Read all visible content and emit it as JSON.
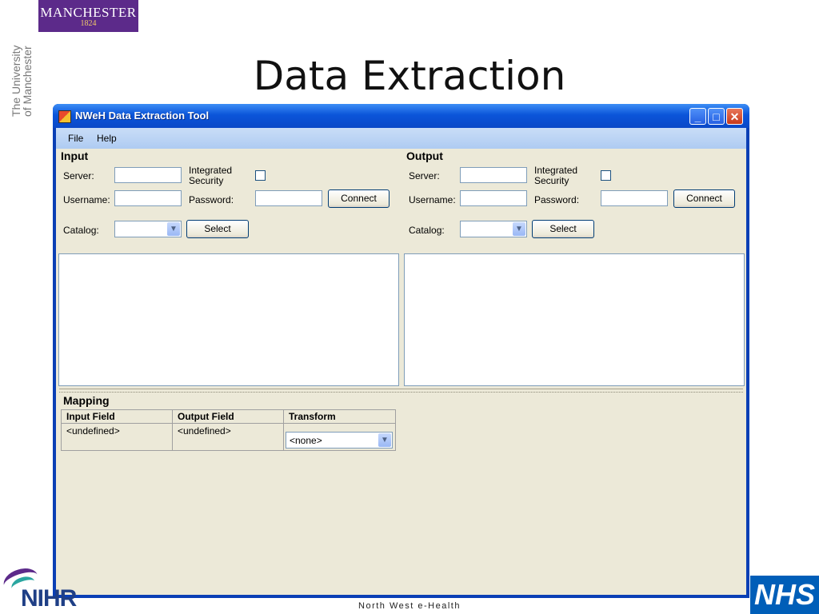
{
  "slide": {
    "title": "Data Extraction",
    "logo_name": "MANCHESTER",
    "logo_year": "1824",
    "university_line1": "The University",
    "university_line2": "of Manchester",
    "footer_text": "North West e-Health",
    "nihr_logo": "NIHR",
    "nhs_logo": "NHS"
  },
  "window": {
    "title": "NWeH Data Extraction Tool",
    "controls": [
      "minimize",
      "maximize",
      "close"
    ]
  },
  "menu": [
    "File",
    "Help"
  ],
  "input": {
    "title": "Input",
    "server_label": "Server:",
    "username_label": "Username:",
    "integrated_label_1": "Integrated",
    "integrated_label_2": "Security",
    "integrated_checked": false,
    "password_label": "Password:",
    "connect_label": "Connect",
    "catalog_label": "Catalog:",
    "catalog_value": "",
    "select_label": "Select"
  },
  "output": {
    "title": "Output",
    "server_label": "Server:",
    "username_label": "Username:",
    "integrated_label_1": "Integrated",
    "integrated_label_2": "Security",
    "integrated_checked": false,
    "password_label": "Password:",
    "connect_label": "Connect",
    "catalog_label": "Catalog:",
    "catalog_value": "",
    "select_label": "Select"
  },
  "mapping": {
    "title": "Mapping",
    "columns": [
      "Input Field",
      "Output Field",
      "Transform"
    ],
    "rows": [
      {
        "input_field": "<undefined>",
        "output_field": "<undefined>",
        "transform": "<none>"
      }
    ]
  }
}
